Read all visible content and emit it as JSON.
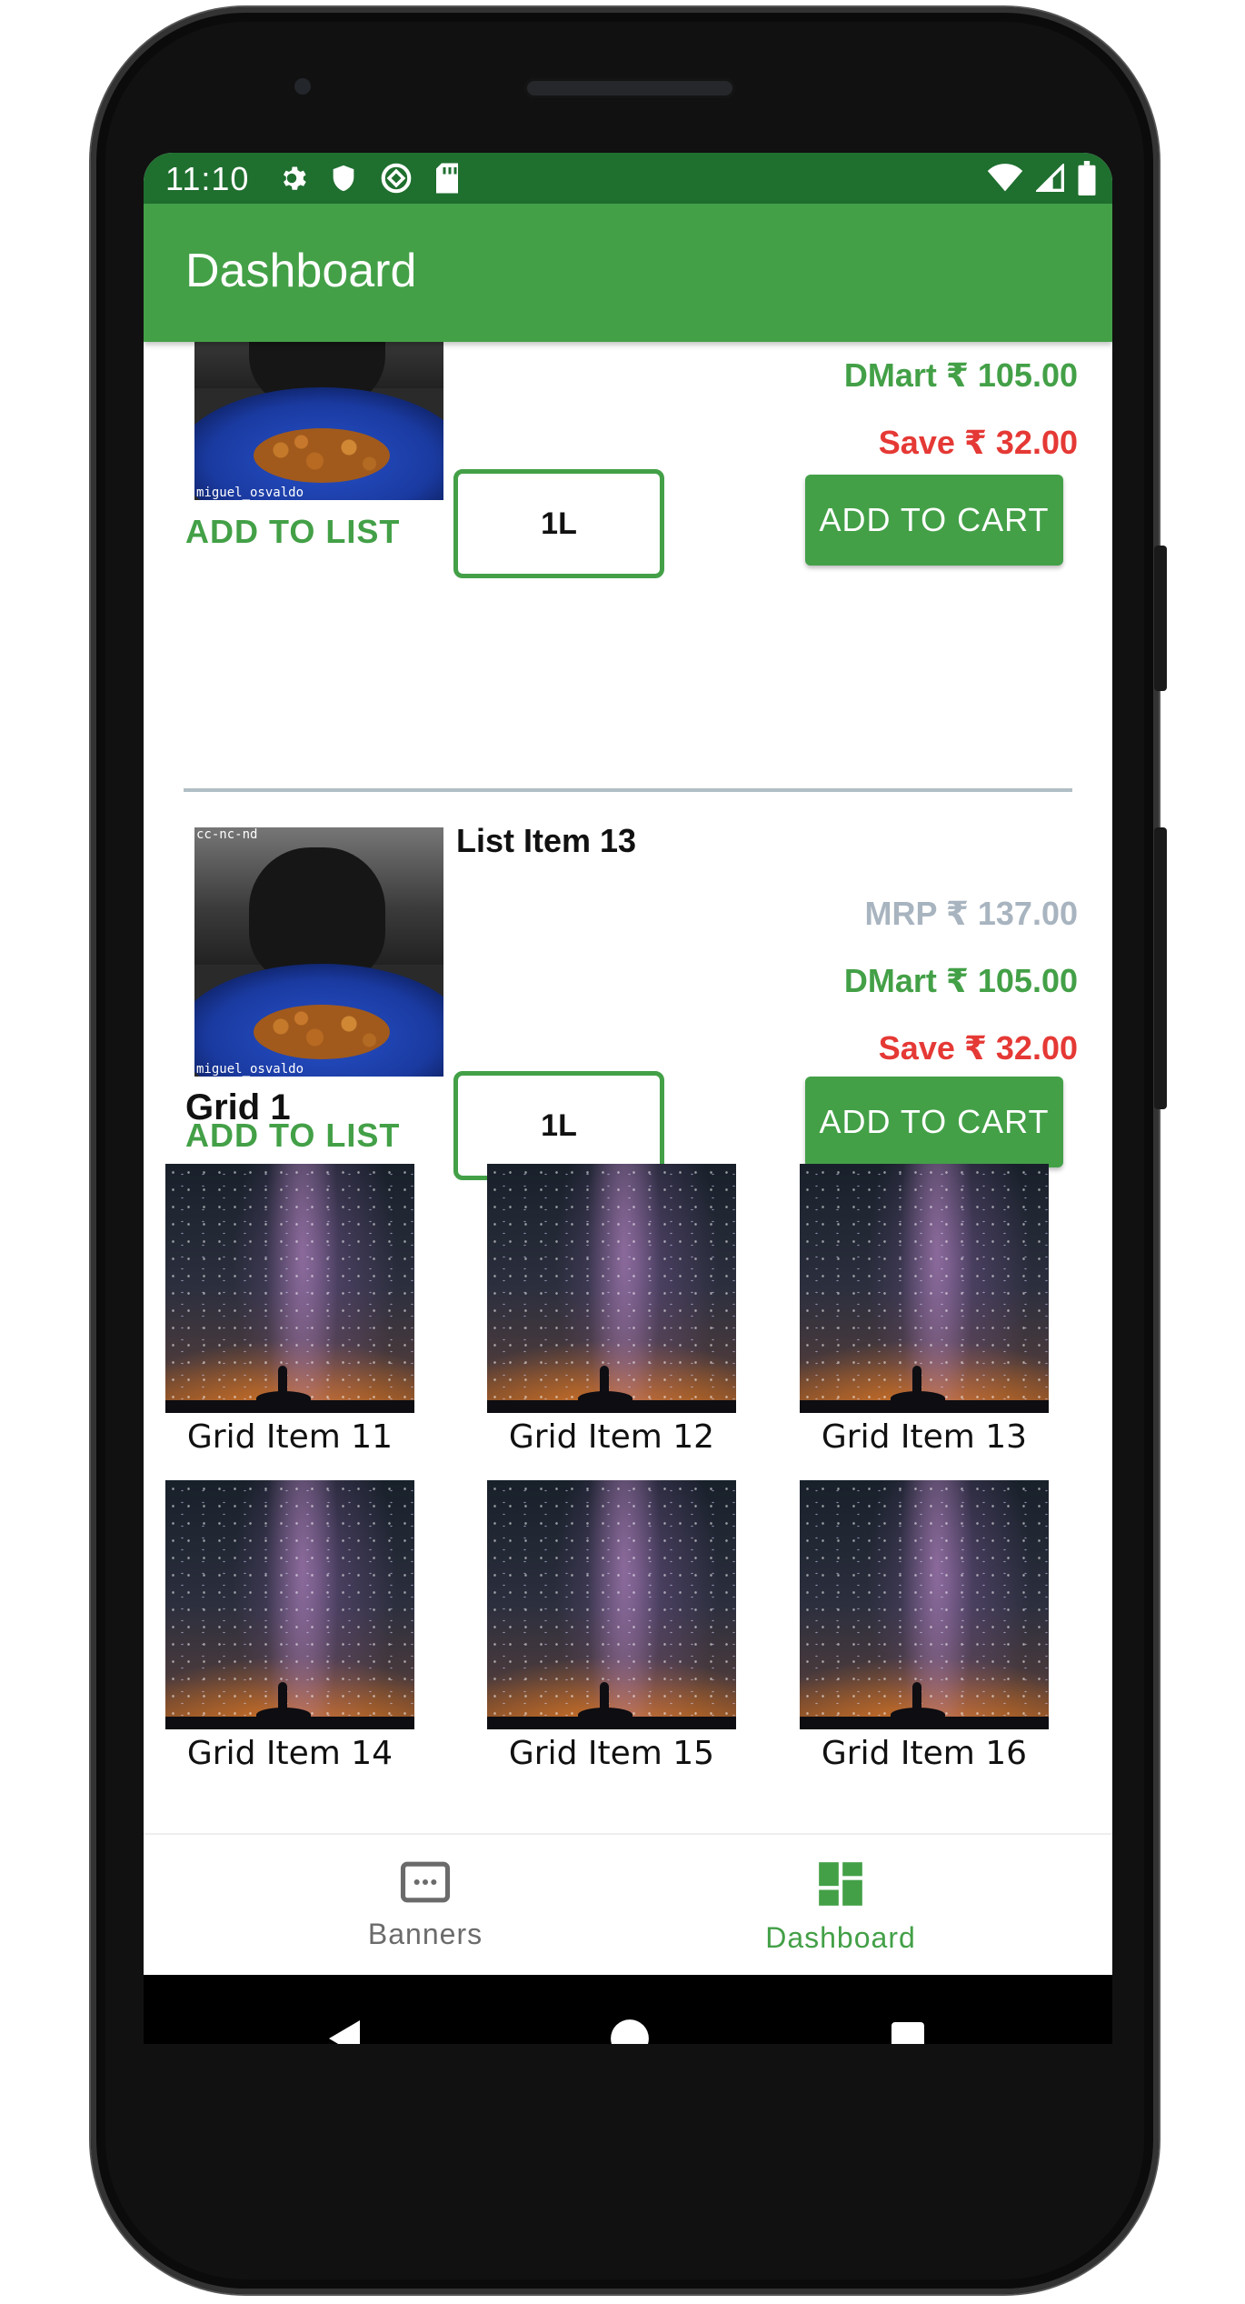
{
  "status_bar": {
    "time": "11:10",
    "left_icons": [
      "settings-icon",
      "shield-icon",
      "data-saver-icon",
      "sd-card-icon"
    ],
    "right_icons": [
      "wifi-icon",
      "signal-icon",
      "battery-icon"
    ]
  },
  "app_bar": {
    "title": "Dashboard",
    "color": "#43a047"
  },
  "list_items": [
    {
      "title": "",
      "mrp": "",
      "dmart": "DMart ₹ 105.00",
      "save": "Save ₹ 32.00",
      "qty": "1L",
      "add_to_list": "ADD TO LIST",
      "add_to_cart": "ADD TO CART",
      "image_watermark_top": "",
      "image_watermark_bottom": "miguel_osvaldo"
    },
    {
      "title": "List Item 13",
      "mrp": "MRP ₹ 137.00",
      "dmart": "DMart ₹ 105.00",
      "save": "Save ₹ 32.00",
      "qty": "1L",
      "add_to_list": "ADD TO LIST",
      "add_to_cart": "ADD TO CART",
      "image_watermark_top": "cc-nc-nd",
      "image_watermark_bottom": "miguel_osvaldo"
    }
  ],
  "grid": {
    "heading": "Grid 1",
    "items": [
      {
        "label": "Grid Item 11"
      },
      {
        "label": "Grid Item 12"
      },
      {
        "label": "Grid Item 13"
      },
      {
        "label": "Grid Item 14"
      },
      {
        "label": "Grid Item 15"
      },
      {
        "label": "Grid Item 16"
      }
    ]
  },
  "bottom_nav": {
    "items": [
      {
        "label": "Banners",
        "icon": "banner-icon",
        "active": false
      },
      {
        "label": "Dashboard",
        "icon": "dashboard-icon",
        "active": true
      }
    ],
    "active_color": "#43a047",
    "inactive_color": "#6b6b6b"
  },
  "system_nav": {
    "buttons": [
      "back-icon",
      "home-icon",
      "recents-icon"
    ]
  },
  "colors": {
    "accent": "#43a047",
    "status_bar": "#1f6f2f",
    "mrp": "#a8b4bf",
    "save": "#e53935"
  }
}
